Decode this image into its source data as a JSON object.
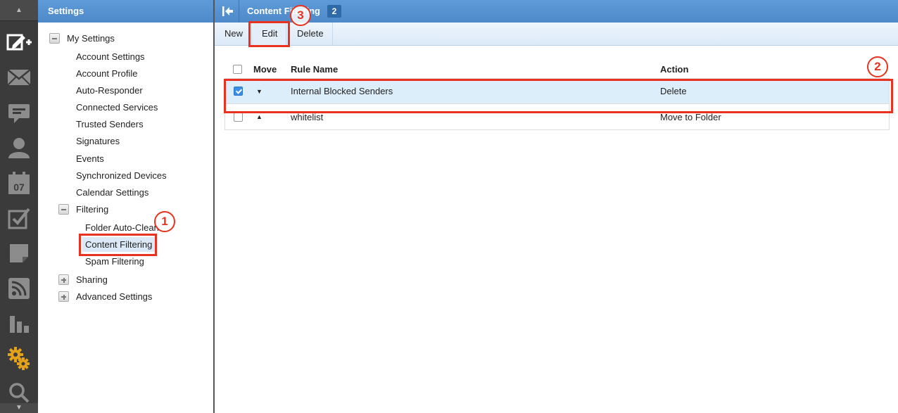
{
  "rail": {
    "icons": [
      "compose-icon",
      "mail-icon",
      "chat-icon",
      "contacts-icon",
      "calendar-icon",
      "tasks-icon",
      "notes-icon",
      "rss-icon",
      "reports-icon",
      "settings-gear-icon",
      "search-icon"
    ],
    "calendar_day": "07",
    "active_icon": "settings-gear-icon",
    "active_color": "#e3a21a"
  },
  "settings": {
    "title": "Settings",
    "tree": {
      "my_settings": "My Settings",
      "items": [
        "Account Settings",
        "Account Profile",
        "Auto-Responder",
        "Connected Services",
        "Trusted Senders",
        "Signatures",
        "Events",
        "Synchronized Devices",
        "Calendar Settings"
      ],
      "filtering": "Filtering",
      "filtering_items": [
        "Folder Auto-Clean",
        "Content Filtering",
        "Spam Filtering"
      ],
      "sharing": "Sharing",
      "advanced": "Advanced Settings"
    },
    "selected": "Content Filtering"
  },
  "main": {
    "title": "Content Filtering",
    "count": "2",
    "toolbar": {
      "new": "New",
      "edit": "Edit",
      "delete": "Delete"
    },
    "columns": {
      "move": "Move",
      "rule_name": "Rule Name",
      "action": "Action"
    },
    "rows": [
      {
        "checked": true,
        "move": "▼",
        "rule_name": "Internal Blocked Senders",
        "action": "Delete"
      },
      {
        "checked": false,
        "move": "▲",
        "rule_name": "whitelist",
        "action": "Move to Folder"
      }
    ]
  },
  "annotations": {
    "step1": "1",
    "step2": "2",
    "step3": "3",
    "color": "#e8321f"
  }
}
